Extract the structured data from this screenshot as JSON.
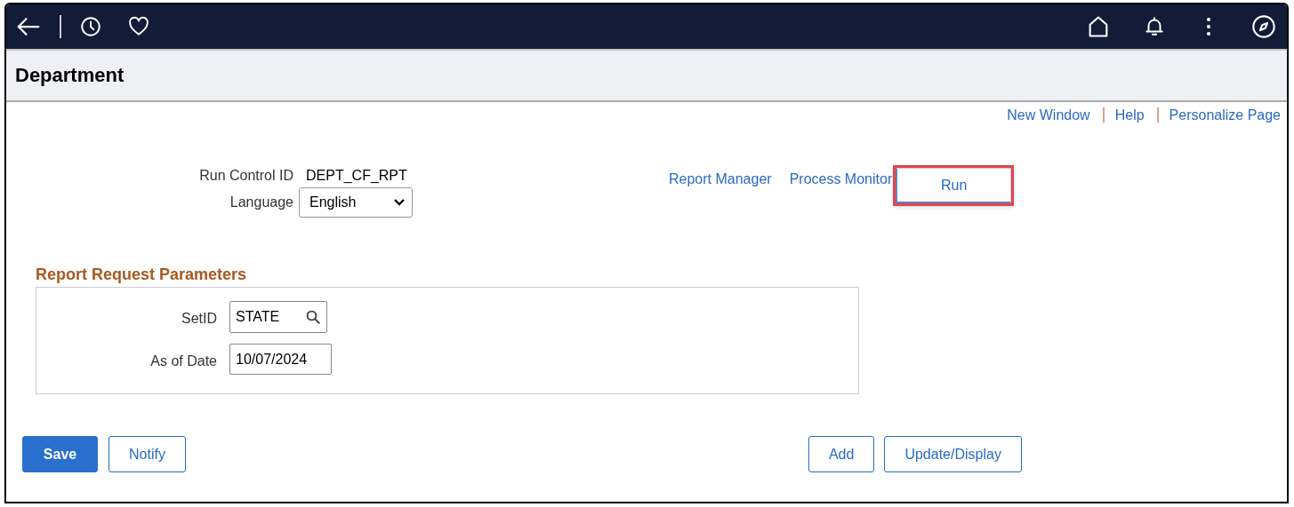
{
  "page_title": "Department",
  "header_links": [
    {
      "label": "New Window"
    },
    {
      "label": "Help"
    },
    {
      "label": "Personalize Page"
    }
  ],
  "run_control": {
    "id_label": "Run Control ID",
    "id_value": "DEPT_CF_RPT",
    "language_label": "Language",
    "language_value": "English"
  },
  "process_links": [
    {
      "label": "Report Manager",
      "kind": "link",
      "highlighted": false
    },
    {
      "label": "Process Monitor",
      "kind": "link",
      "highlighted": false
    },
    {
      "label": "Run",
      "kind": "button",
      "highlighted": true
    }
  ],
  "parameters": {
    "title": "Report Request Parameters",
    "fields": [
      {
        "label": "SetID",
        "value": "STATE",
        "kind": "lookup"
      },
      {
        "label": "As of Date",
        "value": "10/07/2024",
        "kind": "date"
      }
    ]
  },
  "left_buttons": [
    {
      "label": "Save",
      "kind": "primary"
    },
    {
      "label": "Notify",
      "kind": "secondary"
    }
  ],
  "right_buttons": [
    {
      "label": "Add",
      "kind": "secondary"
    },
    {
      "label": "Update/Display",
      "kind": "secondary"
    }
  ]
}
